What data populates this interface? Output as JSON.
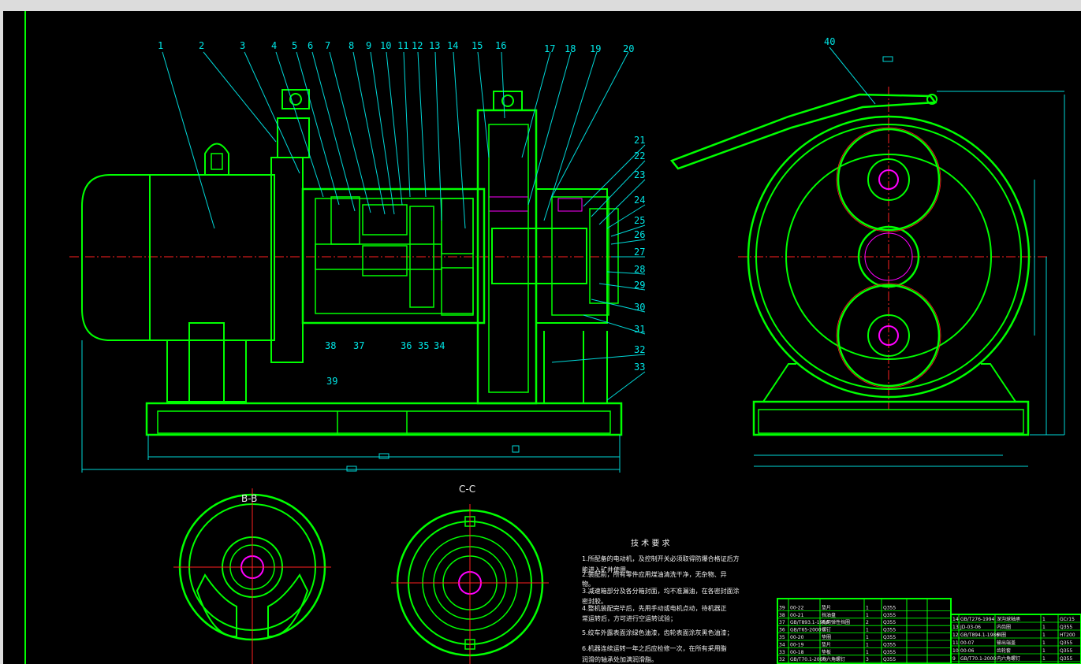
{
  "balloons_left": [
    "1",
    "2",
    "3",
    "4",
    "5",
    "6",
    "7",
    "8",
    "9",
    "10",
    "11",
    "12",
    "13",
    "14",
    "15",
    "16",
    "17",
    "18",
    "19",
    "20"
  ],
  "balloons_right": [
    "21",
    "22",
    "23",
    "24",
    "25",
    "26",
    "27",
    "28",
    "29",
    "30",
    "31",
    "32",
    "33"
  ],
  "balloons_bottom": [
    "38",
    "37",
    "36",
    "35",
    "34"
  ],
  "balloon_39": "39",
  "balloon_40": "40",
  "section_b": "B-B",
  "section_c": "C-C",
  "tech": {
    "title": "技 术 要 求",
    "lines": [
      "1.所配备的电动机，及控制开关必须取得防爆合格证后方",
      "能进入矿井使用。",
      "2.装配前，所有零件应用煤油清洗干净，无杂物、异",
      "物。",
      "3.减速箱部分及各分箱封面，均不准漏油，在各密封面涂",
      "密封胶。",
      "4.整机装配完毕后，先用手动或电机点动，待机器正",
      "常运转后，方可进行空运转试验；",
      "5.绞车外露表面涂绿色油漆，齿轮表面涂灰黑色油漆；",
      "6.机器连续运转一年之后应检修一次，在所有采用脂",
      "润滑的轴承处加满润滑脂。"
    ]
  },
  "bom_left": [
    [
      "39",
      "00-22",
      "垫片",
      "1",
      "Q355",
      ""
    ],
    [
      "38",
      "00-21",
      "挡油盘",
      "1",
      "Q355",
      ""
    ],
    [
      "37",
      "GB/T893.1-1986",
      "孔用弹性挡圈",
      "2",
      "Q355",
      ""
    ],
    [
      "36",
      "GB/T65-2000",
      "螺钉",
      "1",
      "Q355",
      ""
    ],
    [
      "35",
      "00-20",
      "垫圈",
      "1",
      "Q355",
      ""
    ],
    [
      "34",
      "00-19",
      "垫片",
      "1",
      "Q355",
      ""
    ],
    [
      "33",
      "00-18",
      "垫板",
      "1",
      "Q355",
      ""
    ],
    [
      "32",
      "GB/T70.1-2000",
      "内六角螺钉",
      "3",
      "Q355",
      ""
    ]
  ],
  "bom_right": [
    [
      "14",
      "GB/T276-1994",
      "深沟球轴承",
      "1",
      "GCr15"
    ],
    [
      "13",
      "JD-03-06",
      "内齿圈",
      "1",
      "Q355"
    ],
    [
      "12",
      "GB/T894.1-1986",
      "挡圈",
      "1",
      "HT200"
    ],
    [
      "11",
      "00-07",
      "输出端盖",
      "1",
      "Q355"
    ],
    [
      "10",
      "00-06",
      "齿轮套",
      "1",
      "Q355"
    ],
    [
      "9",
      "GB/T70.1-2000",
      "内六角螺钉",
      "1",
      "Q355"
    ]
  ]
}
